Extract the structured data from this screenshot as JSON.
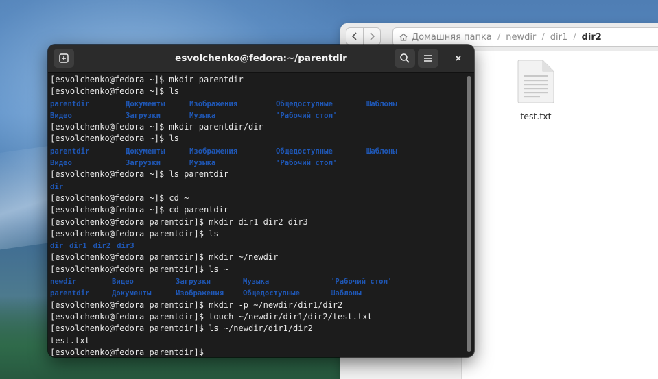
{
  "file_manager": {
    "breadcrumb": [
      "Домашняя папка",
      "newdir",
      "dir1",
      "dir2"
    ],
    "files": [
      {
        "name": "test.txt",
        "icon": "text-file-icon"
      }
    ]
  },
  "terminal": {
    "title": "esvolchenko@fedora:~/parentdir",
    "lines": [
      {
        "type": "text",
        "text": "[esvolchenko@fedora ~]$ mkdir parentdir"
      },
      {
        "type": "text",
        "text": "[esvolchenko@fedora ~]$ ls"
      },
      {
        "type": "dirs",
        "items": [
          "parentdir",
          "Документы",
          "Изображения",
          "Общедоступные",
          "Шаблоны"
        ]
      },
      {
        "type": "dirs",
        "items": [
          "Видео",
          "Загрузки",
          "Музыка",
          "'Рабочий стол'"
        ]
      },
      {
        "type": "text",
        "text": "[esvolchenko@fedora ~]$ mkdir parentdir/dir"
      },
      {
        "type": "text",
        "text": "[esvolchenko@fedora ~]$ ls"
      },
      {
        "type": "dirs",
        "items": [
          "parentdir",
          "Документы",
          "Изображения",
          "Общедоступные",
          "Шаблоны"
        ]
      },
      {
        "type": "dirs",
        "items": [
          "Видео",
          "Загрузки",
          "Музыка",
          "'Рабочий стол'"
        ]
      },
      {
        "type": "text",
        "text": "[esvolchenko@fedora ~]$ ls parentdir"
      },
      {
        "type": "dirs",
        "items": [
          "dir"
        ]
      },
      {
        "type": "text",
        "text": "[esvolchenko@fedora ~]$ cd ~"
      },
      {
        "type": "text",
        "text": "[esvolchenko@fedora ~]$ cd parentdir"
      },
      {
        "type": "text",
        "text": "[esvolchenko@fedora parentdir]$ mkdir dir1 dir2 dir3"
      },
      {
        "type": "text",
        "text": "[esvolchenko@fedora parentdir]$ ls"
      },
      {
        "type": "dirs",
        "inline": true,
        "items": [
          "dir",
          "dir1",
          "dir2",
          "dir3"
        ]
      },
      {
        "type": "text",
        "text": "[esvolchenko@fedora parentdir]$ mkdir ~/newdir"
      },
      {
        "type": "text",
        "text": "[esvolchenko@fedora parentdir]$ ls ~"
      },
      {
        "type": "dirs",
        "items": [
          "newdir",
          "Видео",
          "Загрузки",
          "Музыка",
          "'Рабочий стол'"
        ],
        "wide": true
      },
      {
        "type": "dirs",
        "items": [
          "parentdir",
          "Документы",
          "Изображения",
          "Общедоступные",
          "Шаблоны"
        ],
        "wide": true
      },
      {
        "type": "text",
        "text": "[esvolchenko@fedora parentdir]$ mkdir -p ~/newdir/dir1/dir2"
      },
      {
        "type": "text",
        "text": "[esvolchenko@fedora parentdir]$ touch ~/newdir/dir1/dir2/test.txt"
      },
      {
        "type": "text",
        "text": "[esvolchenko@fedora parentdir]$ ls ~/newdir/dir1/dir2"
      },
      {
        "type": "text",
        "text": "test.txt"
      },
      {
        "type": "text",
        "text": "[esvolchenko@fedora parentdir]$ "
      }
    ]
  },
  "colors": {
    "directory": "#1f57b5",
    "terminal_bg": "#1c1c1c",
    "text": "#e6e6e6"
  }
}
